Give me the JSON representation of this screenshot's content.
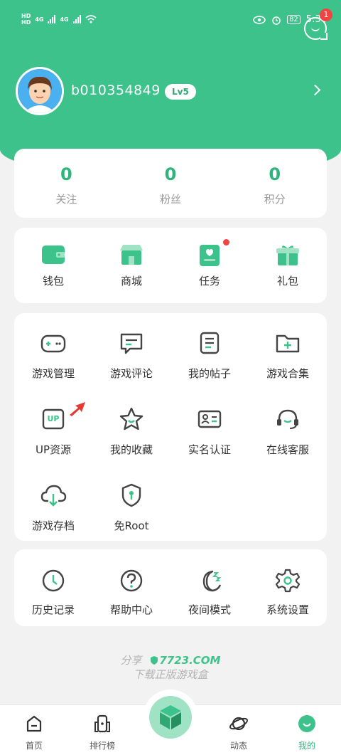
{
  "status_bar": {
    "hd1": "HD",
    "hd2": "HD",
    "net1": "4G",
    "net2": "4G",
    "battery": "82",
    "time": "5:34"
  },
  "header": {
    "message_badge": "1",
    "username": "b010354849",
    "level": "Lv5"
  },
  "stats": [
    {
      "value": "0",
      "label": "关注"
    },
    {
      "value": "0",
      "label": "粉丝"
    },
    {
      "value": "0",
      "label": "积分"
    }
  ],
  "quick_actions": [
    {
      "label": "钱包",
      "icon": "wallet-icon"
    },
    {
      "label": "商城",
      "icon": "store-icon"
    },
    {
      "label": "任务",
      "icon": "task-icon"
    },
    {
      "label": "礼包",
      "icon": "gift-icon"
    }
  ],
  "tools": [
    {
      "label": "游戏管理",
      "icon": "gamepad-icon"
    },
    {
      "label": "游戏评论",
      "icon": "comment-icon"
    },
    {
      "label": "我的帖子",
      "icon": "posts-icon"
    },
    {
      "label": "游戏合集",
      "icon": "folder-add-icon"
    },
    {
      "label": "UP资源",
      "icon": "up-resource-icon",
      "icon_text": "UP"
    },
    {
      "label": "我的收藏",
      "icon": "star-icon"
    },
    {
      "label": "实名认证",
      "icon": "id-card-icon"
    },
    {
      "label": "在线客服",
      "icon": "headset-icon"
    },
    {
      "label": "游戏存档",
      "icon": "cloud-download-icon"
    },
    {
      "label": "免Root",
      "icon": "shield-icon"
    }
  ],
  "misc": [
    {
      "label": "历史记录",
      "icon": "clock-icon"
    },
    {
      "label": "帮助中心",
      "icon": "help-icon"
    },
    {
      "label": "夜间模式",
      "icon": "moon-icon"
    },
    {
      "label": "系统设置",
      "icon": "gear-icon"
    }
  ],
  "promo": {
    "share": "分享",
    "site": "7723.COM",
    "slogan": "下载正版游戏盒"
  },
  "tabbar": [
    {
      "label": "首页",
      "icon": "home-icon"
    },
    {
      "label": "排行榜",
      "icon": "ranking-icon"
    },
    {
      "label": "动态",
      "icon": "planet-icon"
    },
    {
      "label": "我的",
      "icon": "me-icon",
      "active": true
    }
  ],
  "colors": {
    "brand": "#3cc28a",
    "accent_text": "#2fb57c",
    "badge": "#f04444"
  }
}
